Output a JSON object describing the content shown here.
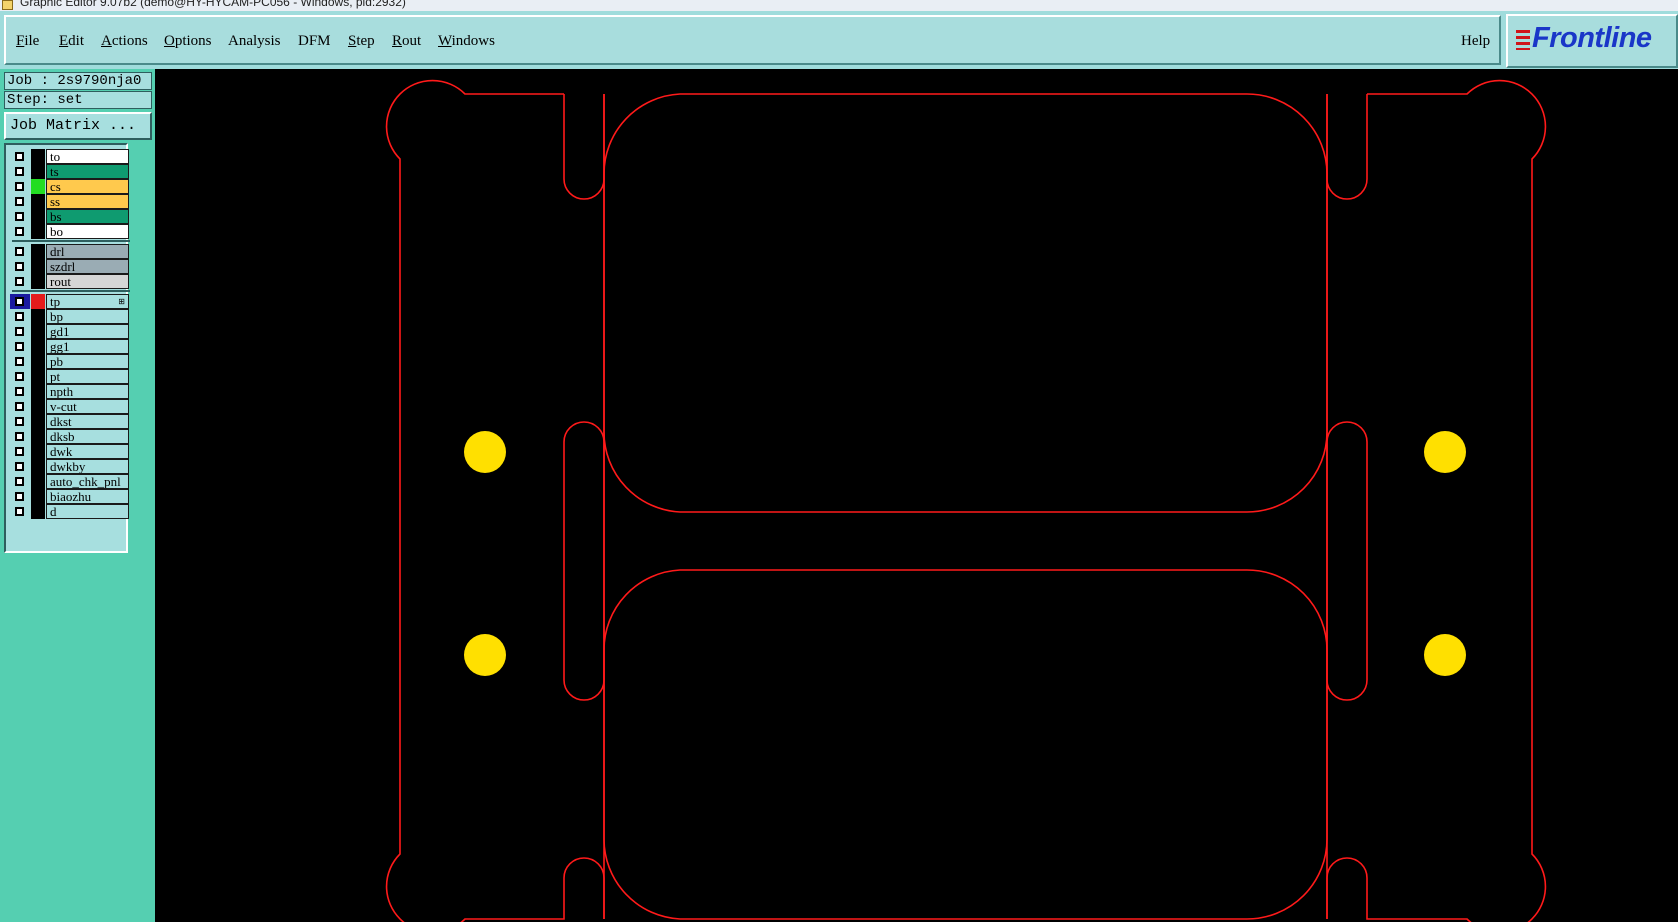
{
  "window": {
    "title": "Graphic Editor 9.07b2 (demo@HY-HYCAM-PC056 - Windows, pid:2932)"
  },
  "menu": [
    {
      "mnemonic": "F",
      "rest": "ile"
    },
    {
      "mnemonic": "E",
      "rest": "dit"
    },
    {
      "mnemonic": "A",
      "rest": "ctions"
    },
    {
      "mnemonic": "O",
      "rest": "ptions"
    },
    {
      "mnemonic": "",
      "rest": "Analysis"
    },
    {
      "mnemonic": "",
      "rest": "DFM"
    },
    {
      "mnemonic": "S",
      "rest": "tep"
    },
    {
      "mnemonic": "R",
      "rest": "out"
    },
    {
      "mnemonic": "W",
      "rest": "indows"
    }
  ],
  "help_label": "Help",
  "logo_text": "Frontline",
  "job_label": "Job : 2s9790nja0",
  "step_label": "Step: set",
  "job_matrix_label": "Job Matrix ...",
  "layers": [
    {
      "name": "to",
      "fill": "#ffffff",
      "swatch": "#000000",
      "group": 0
    },
    {
      "name": "ts",
      "fill": "#0f9b70",
      "swatch": "#000000",
      "group": 0
    },
    {
      "name": "cs",
      "fill": "#ffc94d",
      "swatch": "#22dd22",
      "group": 0
    },
    {
      "name": "ss",
      "fill": "#ffc94d",
      "swatch": "#000000",
      "group": 0
    },
    {
      "name": "bs",
      "fill": "#0f9b70",
      "swatch": "#000000",
      "group": 0
    },
    {
      "name": "bo",
      "fill": "#ffffff",
      "swatch": "#000000",
      "group": 0
    },
    {
      "name": "drl",
      "fill": "#9aacb4",
      "swatch": "#000000",
      "group": 1
    },
    {
      "name": "szdrl",
      "fill": "#9aacb4",
      "swatch": "#000000",
      "group": 1
    },
    {
      "name": "rout",
      "fill": "#d6d6d6",
      "swatch": "#000000",
      "group": 1
    },
    {
      "name": "tp",
      "fill": "#a7dfdf",
      "swatch": "#e41b1b",
      "group": 2,
      "selected": true
    },
    {
      "name": "bp",
      "fill": "#a7dfdf",
      "swatch": "#000000",
      "group": 2
    },
    {
      "name": "gd1",
      "fill": "#a7dfdf",
      "swatch": "#000000",
      "group": 2
    },
    {
      "name": "gg1",
      "fill": "#a7dfdf",
      "swatch": "#000000",
      "group": 2
    },
    {
      "name": "pb",
      "fill": "#a7dfdf",
      "swatch": "#000000",
      "group": 2
    },
    {
      "name": "pt",
      "fill": "#a7dfdf",
      "swatch": "#000000",
      "group": 2
    },
    {
      "name": "npth",
      "fill": "#a7dfdf",
      "swatch": "#000000",
      "group": 2
    },
    {
      "name": "v-cut",
      "fill": "#a7dfdf",
      "swatch": "#000000",
      "group": 2
    },
    {
      "name": "dkst",
      "fill": "#a7dfdf",
      "swatch": "#000000",
      "group": 2
    },
    {
      "name": "dksb",
      "fill": "#a7dfdf",
      "swatch": "#000000",
      "group": 2
    },
    {
      "name": "dwk",
      "fill": "#a7dfdf",
      "swatch": "#000000",
      "group": 2
    },
    {
      "name": "dwkby",
      "fill": "#a7dfdf",
      "swatch": "#000000",
      "group": 2
    },
    {
      "name": "auto_chk_pnl",
      "fill": "#a7dfdf",
      "swatch": "#000000",
      "group": 2
    },
    {
      "name": "biaozhu",
      "fill": "#a7dfdf",
      "swatch": "#000000",
      "group": 2
    },
    {
      "name": "d",
      "fill": "#a7dfdf",
      "swatch": "#000000",
      "group": 2
    }
  ],
  "colors": {
    "menubar": "#9fdcdc",
    "sidebar": "#55cfb1",
    "canvas_bg": "#000000",
    "profile_line": "#ff1a1a",
    "tooling_hole": "#ffe000"
  }
}
